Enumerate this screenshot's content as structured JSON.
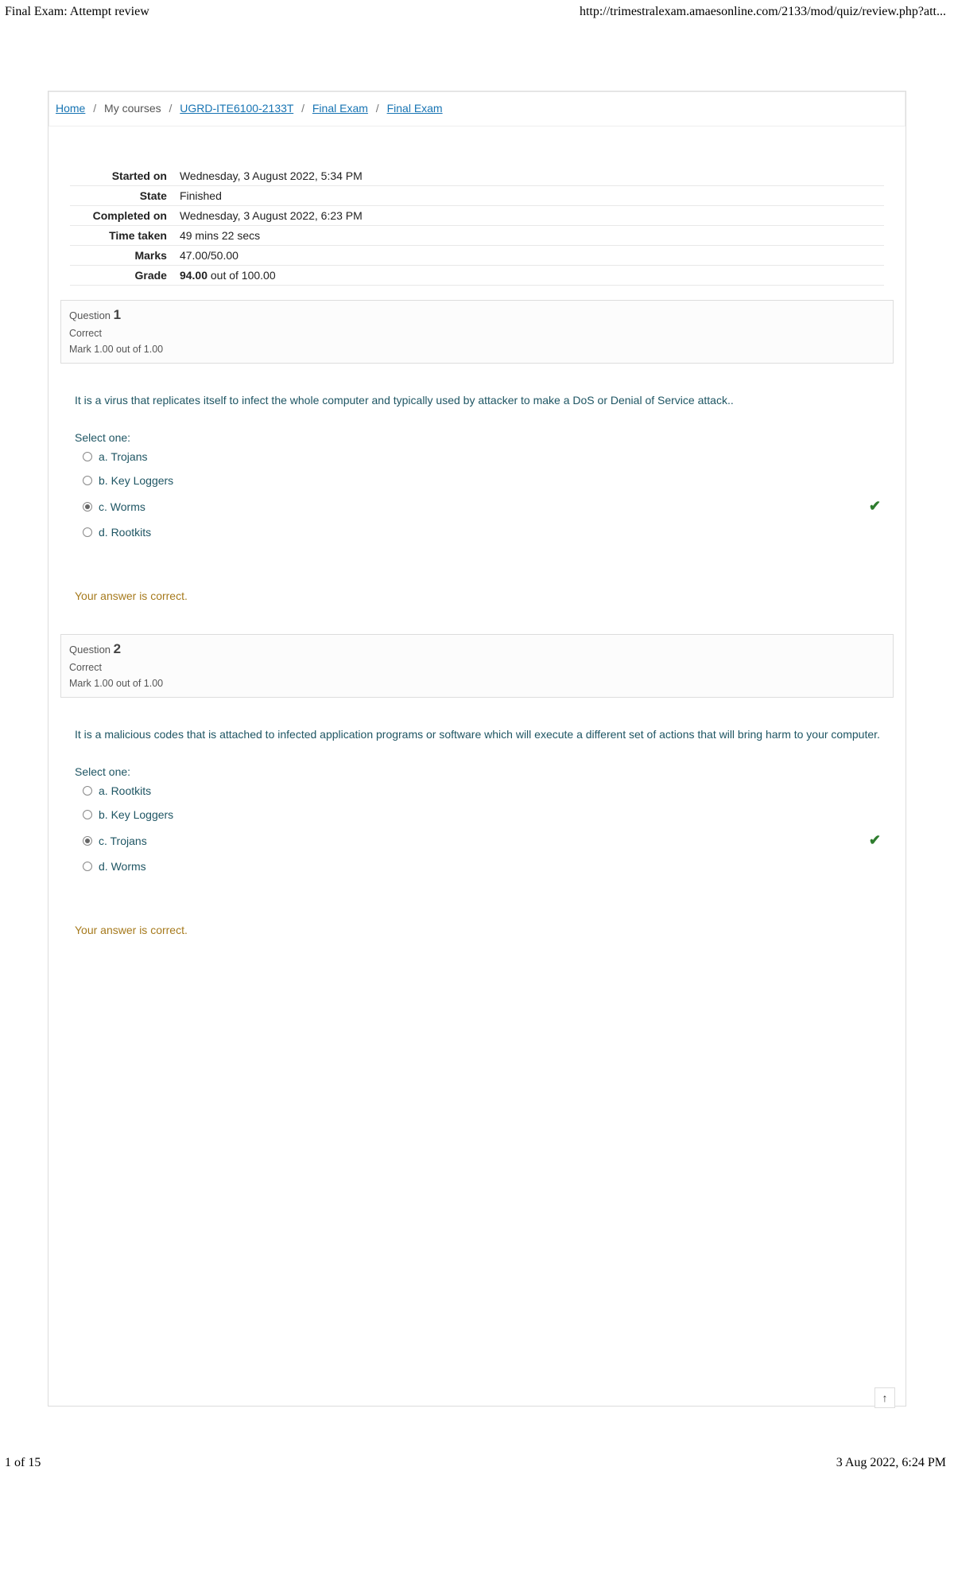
{
  "header": {
    "title": "Final Exam: Attempt review",
    "url": "http://trimestralexam.amaesonline.com/2133/mod/quiz/review.php?att..."
  },
  "breadcrumb": {
    "home": "Home",
    "my_courses": "My courses",
    "course": "UGRD-ITE6100-2133T",
    "exam1": "Final Exam",
    "exam2": "Final Exam"
  },
  "summary": {
    "started_label": "Started on",
    "started_value": "Wednesday, 3 August 2022, 5:34 PM",
    "state_label": "State",
    "state_value": "Finished",
    "completed_label": "Completed on",
    "completed_value": "Wednesday, 3 August 2022, 6:23 PM",
    "time_label": "Time taken",
    "time_value": "49 mins 22 secs",
    "marks_label": "Marks",
    "marks_value": "47.00/50.00",
    "grade_label": "Grade",
    "grade_strong": "94.00",
    "grade_rest": " out of 100.00"
  },
  "q1": {
    "title_prefix": "Question ",
    "number": "1",
    "status": "Correct",
    "mark": "Mark 1.00 out of 1.00",
    "text": "It is a virus that replicates itself to infect the whole computer and typically used by attacker to make a DoS or Denial of Service attack..",
    "select_one": "Select one:",
    "opt_a": "a. Trojans",
    "opt_b": "b. Key Loggers",
    "opt_c": "c. Worms",
    "opt_d": "d. Rootkits",
    "feedback": "Your answer is correct."
  },
  "q2": {
    "title_prefix": "Question ",
    "number": "2",
    "status": "Correct",
    "mark": "Mark 1.00 out of 1.00",
    "text": "It is a malicious codes that is attached to infected application programs or software which will execute a different set of actions that will bring harm to your computer.",
    "select_one": "Select one:",
    "opt_a": "a. Rootkits",
    "opt_b": "b. Key Loggers",
    "opt_c": "c. Trojans",
    "opt_d": "d. Worms",
    "feedback": "Your answer is correct."
  },
  "footer": {
    "page": "1 of 15",
    "date": "3 Aug 2022, 6:24 PM"
  }
}
